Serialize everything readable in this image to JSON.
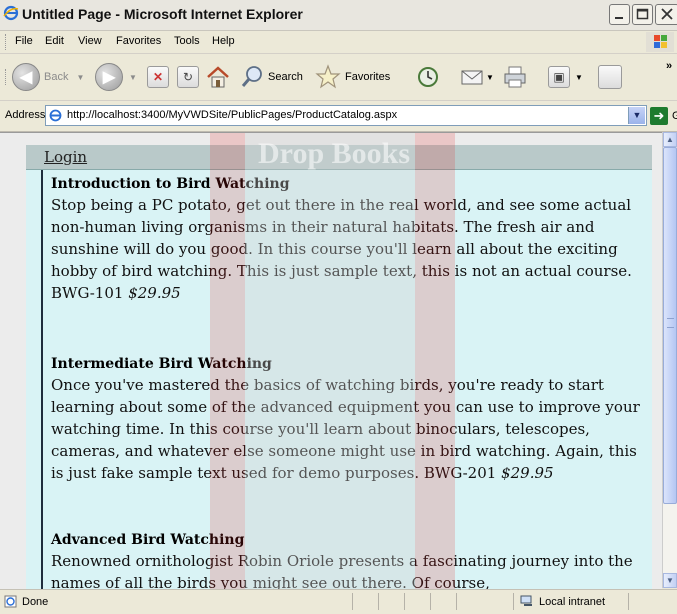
{
  "window": {
    "title": "Untitled Page - Microsoft Internet Explorer",
    "buttons": [
      "minimize",
      "maximize",
      "close"
    ]
  },
  "menubar": {
    "items": [
      "File",
      "Edit",
      "View",
      "Favorites",
      "Tools",
      "Help"
    ]
  },
  "toolbar": {
    "back_label": "Back",
    "search_label": "Search",
    "favorites_label": "Favorites",
    "overflow": "»"
  },
  "address": {
    "label": "Address",
    "url": "http://localhost:3400/MyVWDSite/PublicPages/ProductCatalog.aspx",
    "go_label": "Go"
  },
  "watermark": {
    "text": "Drop Books"
  },
  "page": {
    "login_label": "Login",
    "courses": [
      {
        "title": "Introduction to Bird Watching",
        "description": "Stop being a PC potato, get out there in the real world, and see some actual non-human living organisms in their natural habitats. The fresh air and sunshine will do you good. In this course you'll learn all about the exciting hobby of bird watching. This is just sample text, this is not an actual course.",
        "code": "BWG-101",
        "price": "$29.95"
      },
      {
        "title": "Intermediate Bird Watching",
        "description": "Once you've mastered the basics of watching birds, you're ready to start learning about some of the advanced equipment you can use to improve your watching time. In this course you'll learn about binoculars, telescopes, cameras, and whatever else someone might use in bird watching. Again, this is just fake sample text used for demo purposes.",
        "code": "BWG-201",
        "price": "$29.95"
      },
      {
        "title": "Advanced Bird Watching",
        "description": "Renowned ornithologist Robin Oriole presents a fascinating journey into the names of all the birds you might see out there. Of course,"
      }
    ]
  },
  "statusbar": {
    "status": "Done",
    "zone": "Local intranet"
  },
  "colors": {
    "page_background": "#d9f3f5",
    "login_bar": "#b9c9c9",
    "catalog_border": "#1f2c3c"
  }
}
